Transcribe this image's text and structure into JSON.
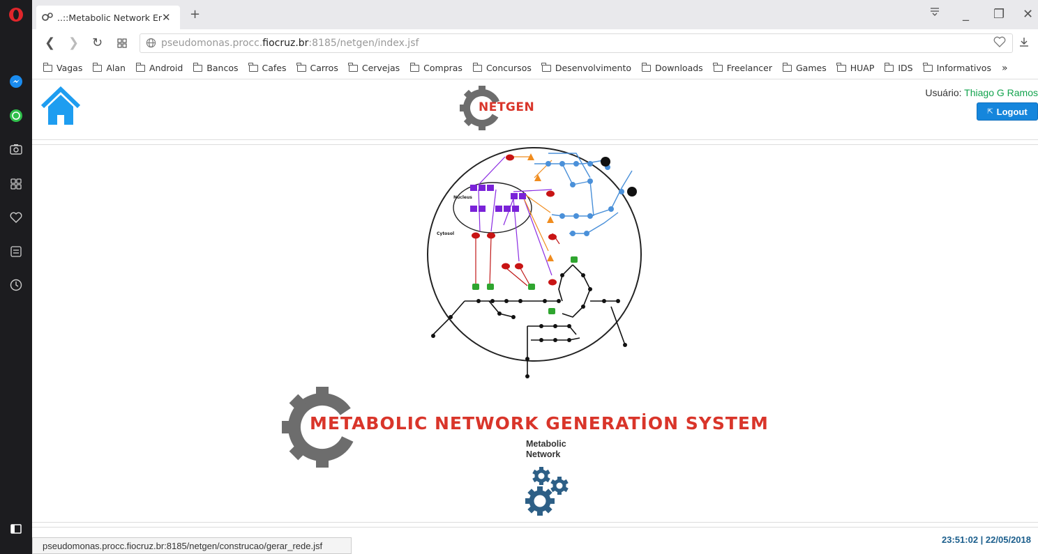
{
  "browser": {
    "tab_title": "..::Metabolic Network Engi",
    "url_prefix": "pseudomonas.procc.",
    "url_domain": "fiocruz.br",
    "url_suffix": ":8185/netgen/index.jsf",
    "status_url": "pseudomonas.procc.fiocruz.br:8185/netgen/construcao/gerar_rede.jsf",
    "bookmarks": [
      "Vagas",
      "Alan",
      "Android",
      "Bancos",
      "Cafes",
      "Carros",
      "Cervejas",
      "Compras",
      "Concursos",
      "Desenvolvimento",
      "Downloads",
      "Freelancer",
      "Games",
      "HUAP",
      "IDS",
      "Informativos"
    ],
    "more_bookmarks": "»"
  },
  "header": {
    "logo_text": "NETGEN",
    "user_label": "Usuário:",
    "user_name": "Thiago G Ramos",
    "logout_label": "Logout"
  },
  "diagram": {
    "nucleus_label": "Nucleus",
    "cytosol_label": "Cytosol"
  },
  "main": {
    "banner_text": "METABOLIC NETWORK GENERATİON SYSTEM",
    "feature_label_line1": "Metabolic",
    "feature_label_line2": "Network"
  },
  "footer": {
    "datetime": "23:51:02 | 22/05/2018"
  },
  "colors": {
    "accent_blue": "#1586dc",
    "brand_red": "#d9352a",
    "user_green": "#12a34d",
    "gear_gray": "#6d6d6d",
    "gear_blue": "#2d5f86"
  }
}
